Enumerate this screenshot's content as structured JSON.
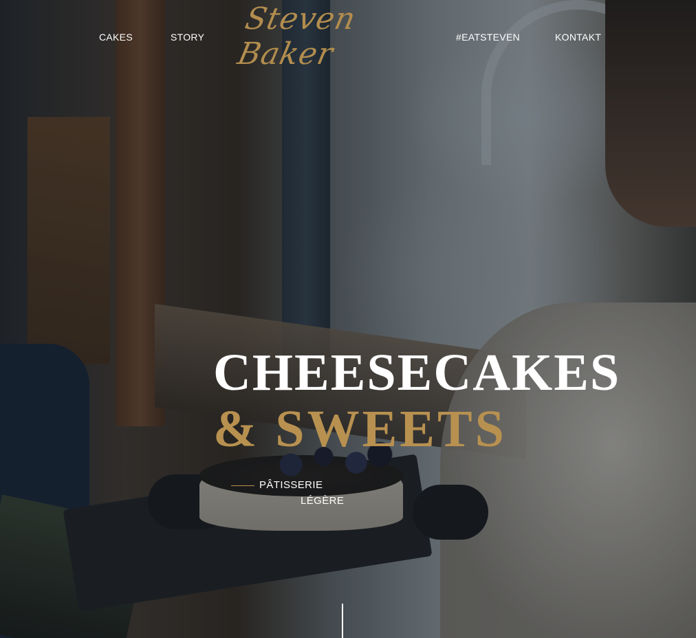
{
  "nav": {
    "cakes_label": "CAKES",
    "story_label": "STORY",
    "eatsteven_label": "#EATSTEVEN",
    "kontakt_label": "KONTAKT"
  },
  "logo": {
    "text": "Steven Baker"
  },
  "hero": {
    "headline_line1": "CHEESECAKES",
    "headline_line2": "& SWEETS",
    "tagline_line1": "PÂTISSERIE",
    "tagline_line2": "LÉGÈRE"
  },
  "colors": {
    "accent_gold": "#b89150",
    "text_white": "#ffffff"
  }
}
